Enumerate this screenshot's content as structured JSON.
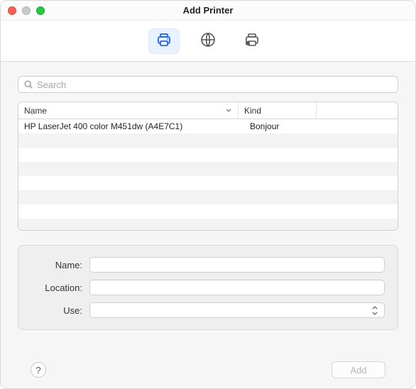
{
  "window": {
    "title": "Add Printer"
  },
  "toolbar": {
    "tabs": [
      {
        "id": "default",
        "active": true,
        "icon": "printer-icon"
      },
      {
        "id": "ip",
        "active": false,
        "icon": "globe-icon"
      },
      {
        "id": "windows",
        "active": false,
        "icon": "shared-printer-icon"
      }
    ]
  },
  "search": {
    "placeholder": "Search",
    "value": ""
  },
  "table": {
    "columns": {
      "name": "Name",
      "kind": "Kind"
    },
    "rows": [
      {
        "name": "HP LaserJet 400 color M451dw (A4E7C1)",
        "kind": "Bonjour"
      }
    ]
  },
  "form": {
    "name": {
      "label": "Name:",
      "value": ""
    },
    "location": {
      "label": "Location:",
      "value": ""
    },
    "use": {
      "label": "Use:",
      "value": ""
    }
  },
  "footer": {
    "help": "?",
    "add_label": "Add",
    "add_enabled": false
  }
}
